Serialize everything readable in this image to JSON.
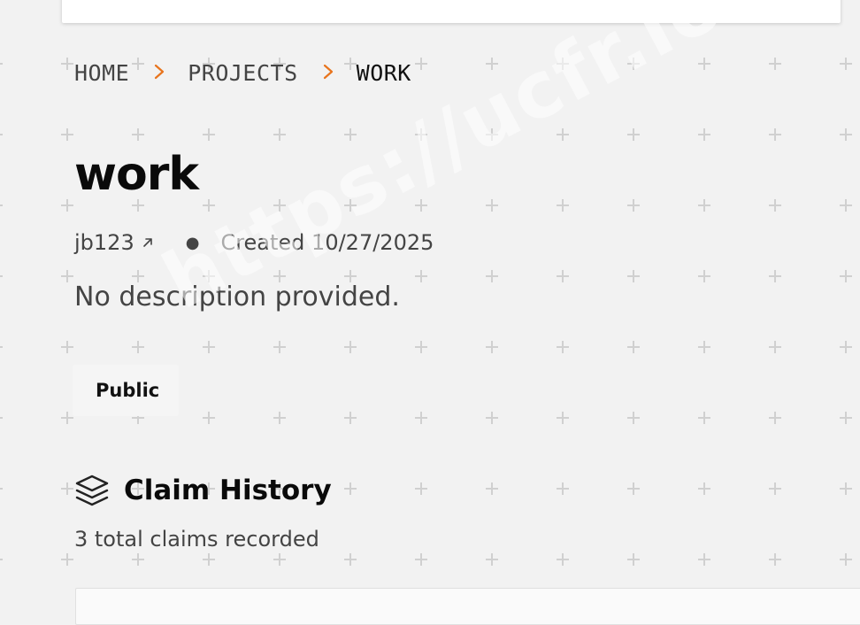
{
  "breadcrumb": {
    "items": [
      {
        "label": "HOME"
      },
      {
        "label": "PROJECTS"
      },
      {
        "label": "WORK"
      }
    ]
  },
  "project": {
    "title": "work",
    "owner": "jb123",
    "created": "Created 10/27/2025",
    "description": "No description provided.",
    "visibility": "Public"
  },
  "claims": {
    "title": "Claim History",
    "subtitle": "3 total claims recorded"
  },
  "watermark": "https://ucfr.io",
  "icons": {
    "breadcrumb_separator": "chevron-right-icon",
    "owner_link": "external-link-icon",
    "claims": "layers-icon"
  },
  "colors": {
    "accent": "#e8741c",
    "background": "#f2f2f2",
    "text_primary": "#111111",
    "text_secondary": "#444444"
  }
}
